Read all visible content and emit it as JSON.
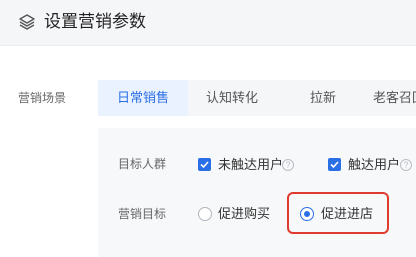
{
  "header": {
    "title": "设置营销参数",
    "icon": "layers-icon"
  },
  "scene": {
    "label": "营销场景",
    "tabs": [
      {
        "label": "日常销售",
        "active": true
      },
      {
        "label": "认知转化",
        "active": false
      },
      {
        "label": "拉新",
        "active": false
      },
      {
        "label": "老客召回",
        "active": false
      }
    ]
  },
  "target_group": {
    "label": "目标人群",
    "options": [
      {
        "label": "未触达用户",
        "checked": true
      },
      {
        "label": "触达用户",
        "checked": true
      }
    ],
    "help_glyph": "?"
  },
  "goal": {
    "label": "营销目标",
    "options": [
      {
        "label": "促进购买",
        "selected": false
      },
      {
        "label": "促进进店",
        "selected": true
      }
    ]
  },
  "colors": {
    "accent": "#2b6fe6",
    "highlight": "#e03a2f",
    "header_bg": "#f5f6f8",
    "panel_bg": "#f7f8fa"
  }
}
